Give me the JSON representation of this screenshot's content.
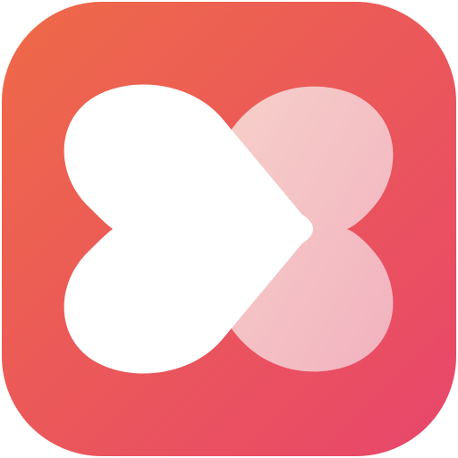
{
  "app_icon": {
    "name": "heart-play-logo",
    "colors": {
      "background_start": "#ee6a48",
      "background_end": "#e8466b",
      "foreground": "#ffffff",
      "overlay_start": "#f6cfca",
      "overlay_end": "#f2b2bf"
    }
  }
}
